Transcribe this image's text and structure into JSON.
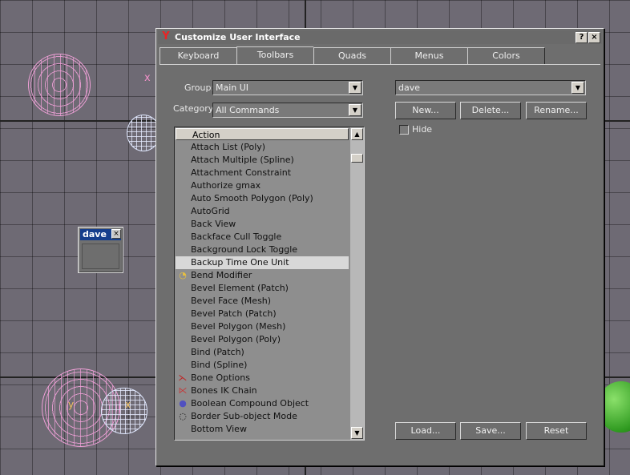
{
  "floating_toolbar": {
    "title": "dave",
    "close": "×"
  },
  "dialog": {
    "title": "Customize User Interface",
    "help_btn": "?",
    "close_btn": "×",
    "tabs": [
      "Keyboard",
      "Toolbars",
      "Quads",
      "Menus",
      "Colors"
    ],
    "group_label": "Group:",
    "group_value": "Main UI",
    "category_label": "Category:",
    "category_value": "All Commands",
    "toolbar_select": "dave",
    "new_btn": "New...",
    "delete_btn": "Delete...",
    "rename_btn": "Rename...",
    "hide_label": "Hide",
    "list_header": "Action",
    "actions": [
      {
        "label": "Attach List (Poly)",
        "icon": ""
      },
      {
        "label": "Attach Multiple (Spline)",
        "icon": ""
      },
      {
        "label": "Attachment Constraint",
        "icon": ""
      },
      {
        "label": "Authorize gmax",
        "icon": ""
      },
      {
        "label": "Auto Smooth Polygon (Poly)",
        "icon": ""
      },
      {
        "label": "AutoGrid",
        "icon": ""
      },
      {
        "label": "Back View",
        "icon": ""
      },
      {
        "label": "Backface Cull Toggle",
        "icon": ""
      },
      {
        "label": "Background Lock Toggle",
        "icon": ""
      },
      {
        "label": "Backup Time One Unit",
        "icon": ""
      },
      {
        "label": "Bend Modifier",
        "icon": "bend-icon"
      },
      {
        "label": "Bevel Element (Patch)",
        "icon": ""
      },
      {
        "label": "Bevel Face (Mesh)",
        "icon": ""
      },
      {
        "label": "Bevel Patch (Patch)",
        "icon": ""
      },
      {
        "label": "Bevel Polygon (Mesh)",
        "icon": ""
      },
      {
        "label": "Bevel Polygon (Poly)",
        "icon": ""
      },
      {
        "label": "Bind (Patch)",
        "icon": ""
      },
      {
        "label": "Bind (Spline)",
        "icon": ""
      },
      {
        "label": "Bone Options",
        "icon": "bone-icon"
      },
      {
        "label": "Bones IK Chain",
        "icon": "ik-chain-icon"
      },
      {
        "label": "Boolean Compound Object",
        "icon": "boolean-icon"
      },
      {
        "label": "Border Sub-object Mode",
        "icon": "border-icon"
      },
      {
        "label": "Bottom View",
        "icon": ""
      }
    ],
    "selected_index": 9,
    "load_btn": "Load...",
    "save_btn": "Save...",
    "reset_btn": "Reset",
    "viewport_axis_labels": [
      "x",
      "y",
      "x"
    ]
  }
}
